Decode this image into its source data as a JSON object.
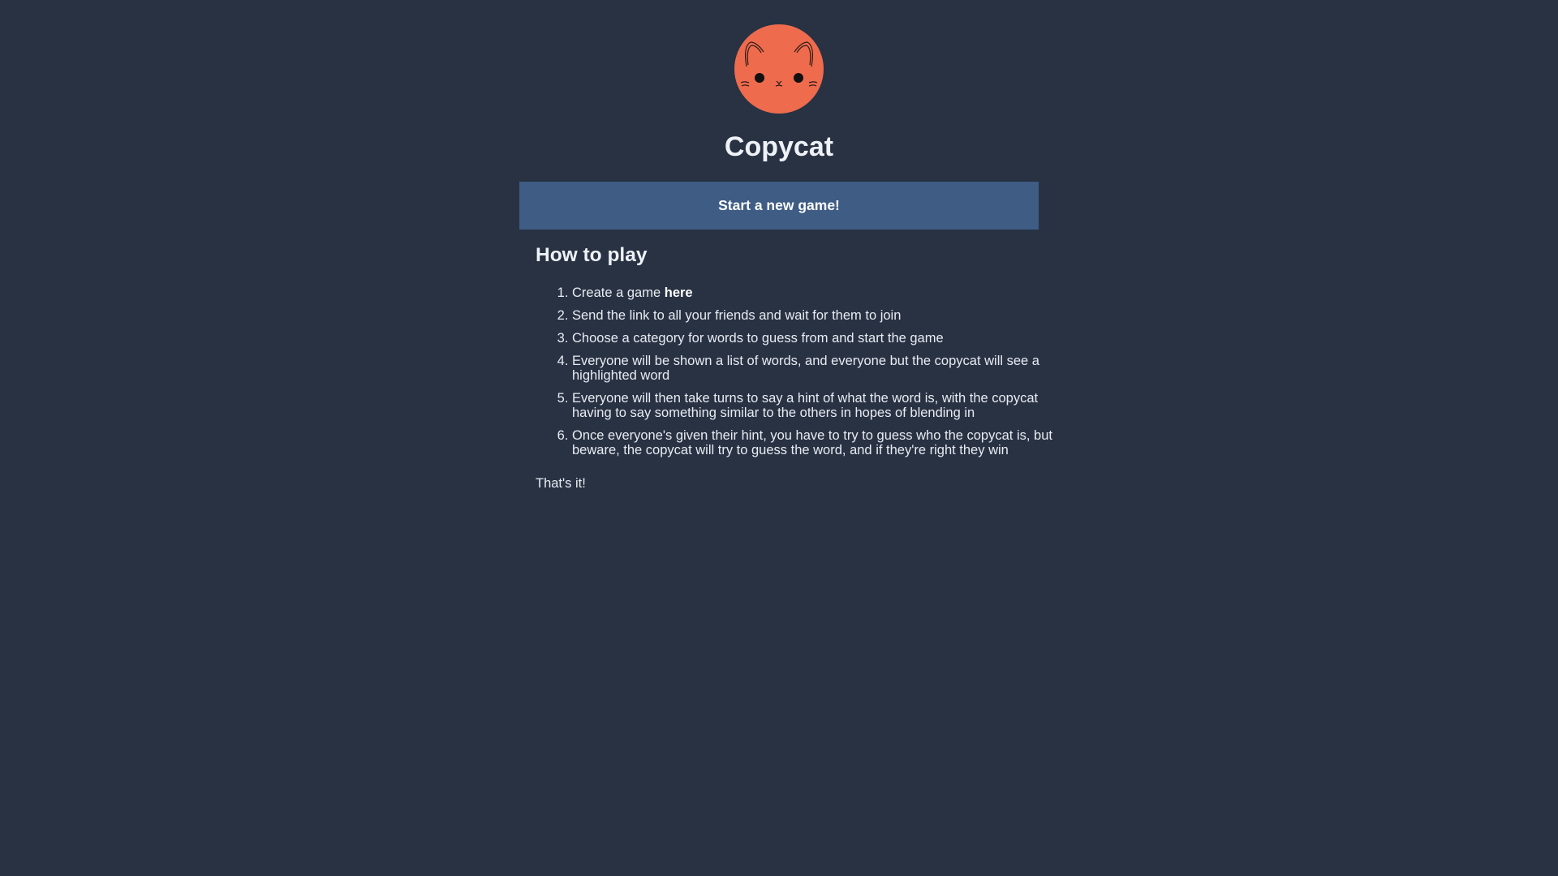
{
  "logo": {
    "icon": "cat-face-icon",
    "color": "#ef6b4e"
  },
  "title": "Copycat",
  "start_button": "Start a new game!",
  "how_to_play": {
    "heading": "How to play",
    "step1_prefix": "Create a game ",
    "step1_link": "here",
    "steps": [
      "Send the link to all your friends and wait for them to join",
      "Choose a category for words to guess from and start the game",
      "Everyone will be shown a list of words, and everyone but the copycat will see a highlighted word",
      "Everyone will then take turns to say a hint of what the word is, with the copycat having to say something similar to the others in hopes of blending in",
      "Once everyone's given their hint, you have to try to guess who the copycat is, but beware, the copycat will try to guess the word, and if they're right they win"
    ],
    "footer": "That's it!"
  },
  "colors": {
    "background": "#283243",
    "button": "#3e5c84"
  }
}
